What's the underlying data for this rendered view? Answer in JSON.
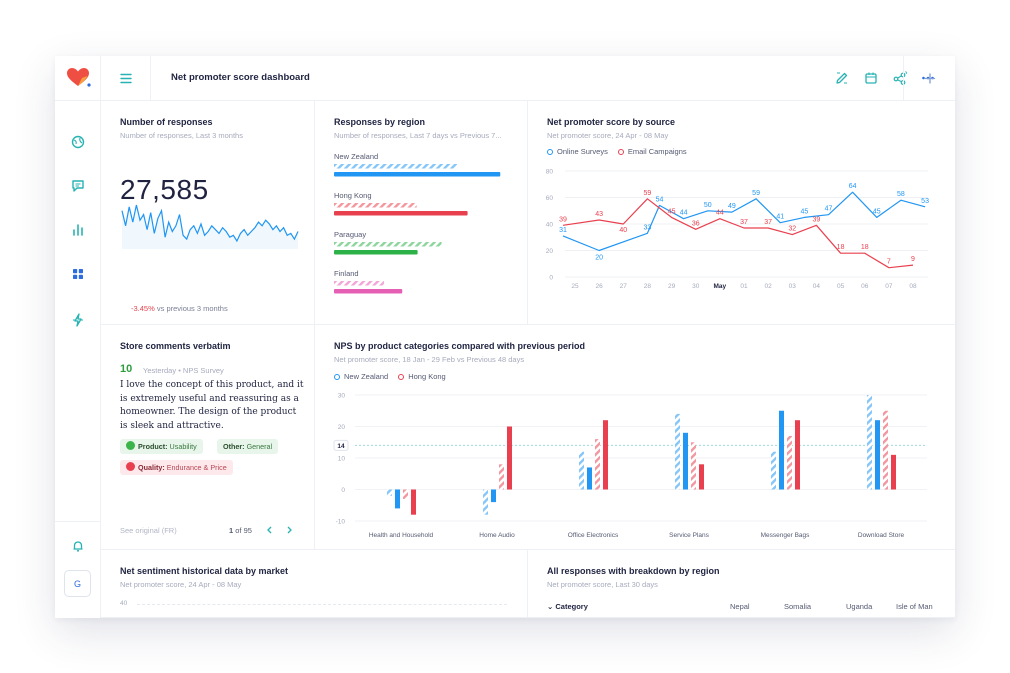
{
  "header": {
    "title": "Net promoter score dashboard"
  },
  "icons": {
    "logo": "heart-logo-icon",
    "menu": "hamburger-menu-icon",
    "rail": [
      "globe-icon",
      "chat-bubble-icon",
      "bar-chart-icon",
      "grid-icon",
      "lightning-icon"
    ],
    "bottom": [
      "bell-icon"
    ],
    "toolbar": [
      "edit-pencil-icon",
      "calendar-icon",
      "share-icon",
      "more-dots-icon",
      "plus-icon"
    ]
  },
  "user": {
    "initial": "G"
  },
  "colors": {
    "blue": "#2196f3",
    "red": "#e9404f",
    "green": "#2db24a",
    "pink": "#e55fb4"
  },
  "responses": {
    "title": "Number of responses",
    "subtitle": "Number of responses, Last 3 months",
    "value": "27,585",
    "delta": "-3.45%",
    "delta_label": "vs previous 3 months",
    "sparkline": [
      20,
      12,
      22,
      14,
      23,
      15,
      18,
      10,
      19,
      8,
      16,
      20,
      6,
      14,
      9,
      12,
      18,
      7,
      5,
      10,
      12,
      8,
      13,
      7,
      9,
      12,
      10,
      8,
      11,
      9,
      6,
      7,
      4,
      8,
      10,
      7,
      9,
      11,
      14,
      12,
      15,
      13,
      10,
      12,
      9,
      11,
      7,
      8,
      5,
      9
    ]
  },
  "regions": {
    "title": "Responses by region",
    "subtitle": "Number of responses, Last 7 days vs Previous 7...",
    "rows": [
      {
        "name": "New Zealand",
        "current": 173,
        "previous": 128
      },
      {
        "name": "Hong Kong",
        "current": 139,
        "previous": 86
      },
      {
        "name": "Paraguay",
        "current": 87,
        "previous": 112
      },
      {
        "name": "Finland",
        "current": 71,
        "previous": 52
      }
    ]
  },
  "nps_source": {
    "title": "Net promoter score by source",
    "subtitle": "Net promoter score, 24 Apr - 08 May",
    "legend": [
      "Online Surveys",
      "Email Campaigns"
    ]
  },
  "comments": {
    "title": "Store comments verbatim",
    "score": "10",
    "date": "Yesterday",
    "source": "• NPS Survey",
    "text": "I love the concept of this product, and it is extremely useful and reassuring as a homeowner. The design of the product is sleek and attractive.",
    "tags": [
      {
        "label": "Product:",
        "value": "Usability"
      },
      {
        "label": "Other:",
        "value": "General"
      },
      {
        "label": "Quality:",
        "value": "Endurance & Price"
      }
    ],
    "see_original": "See original (FR)",
    "page": "1",
    "page_total": "of 95"
  },
  "categories": {
    "title": "NPS by product categories compared with previous period",
    "subtitle": "Net promoter score, 18 Jan - 29 Feb vs Previous 48 days",
    "legend": [
      "New Zealand",
      "Hong Kong"
    ]
  },
  "sentiment": {
    "title": "Net sentiment historical data by market",
    "subtitle": "Net promoter score, 24 Apr - 08 May",
    "ytop": "40"
  },
  "breakdown": {
    "title": "All responses with breakdown by region",
    "subtitle": "Net promoter score, Last 30 days",
    "category_header": "Category",
    "columns": [
      "Nepal",
      "Somalia",
      "Uganda",
      "Isle of Man"
    ]
  },
  "chart_data": [
    {
      "type": "line",
      "title": "Net promoter score by source",
      "x": [
        "25",
        "26",
        "27",
        "28",
        "29",
        "30",
        "May",
        "01",
        "02",
        "03",
        "04",
        "05",
        "06",
        "07",
        "08"
      ],
      "ylim": [
        0,
        80
      ],
      "yticks": [
        "0",
        "20",
        "40",
        "60",
        "80"
      ],
      "grid": true,
      "legend": "top-left",
      "series": [
        {
          "name": "Online Surveys",
          "color": "#2196f3",
          "values": [
            31,
            20,
            null,
            33,
            54,
            44,
            50,
            49,
            59,
            41,
            45,
            47,
            64,
            45,
            58,
            53
          ],
          "points": [
            [
              0,
              31
            ],
            [
              1,
              20
            ],
            [
              3,
              33
            ],
            [
              3.5,
              54
            ],
            [
              4.5,
              44
            ],
            [
              5.5,
              50
            ],
            [
              6.5,
              49
            ],
            [
              7.5,
              59
            ],
            [
              8.5,
              41
            ],
            [
              9.5,
              45
            ],
            [
              10.5,
              47
            ],
            [
              11.5,
              64
            ],
            [
              12.5,
              45
            ],
            [
              13.5,
              58
            ],
            [
              14.5,
              53
            ]
          ]
        },
        {
          "name": "Email Campaigns",
          "color": "#e9404f",
          "points": [
            [
              0,
              39
            ],
            [
              1,
              43
            ],
            [
              2,
              40
            ],
            [
              3,
              59
            ],
            [
              4,
              45
            ],
            [
              5,
              36
            ],
            [
              6,
              44
            ],
            [
              7,
              37
            ],
            [
              8,
              37
            ],
            [
              9,
              32
            ],
            [
              10,
              39
            ],
            [
              11,
              18
            ],
            [
              12,
              18
            ],
            [
              13,
              7
            ],
            [
              14,
              9
            ]
          ]
        }
      ],
      "point_labels": {
        "Online Surveys": [
          "31",
          "20",
          "33",
          "54",
          "44",
          "50",
          "49",
          "59",
          "41",
          "45",
          "47",
          "64",
          "45",
          "58",
          "53"
        ],
        "Email Campaigns": [
          "39",
          "43",
          "40",
          "59",
          "45",
          "36",
          "44",
          "37",
          "37",
          "32",
          "39",
          "18",
          "18",
          "7",
          "9"
        ]
      }
    },
    {
      "type": "bar",
      "title": "NPS by product categories compared with previous period",
      "categories": [
        "Health and Household",
        "Home Audio",
        "Office Electronics",
        "Service Plans",
        "Messenger Bags",
        "Download Store"
      ],
      "ylim": [
        -10,
        30
      ],
      "yticks": [
        "-10",
        "0",
        "10",
        "20",
        "30"
      ],
      "reference_line": 14,
      "reference_label": "14",
      "legend": "top-left",
      "series": [
        {
          "name": "New Zealand",
          "color": "#2196f3",
          "previous": [
            -2,
            -8,
            12,
            24,
            12,
            30
          ],
          "current": [
            -6,
            -4,
            7,
            18,
            25,
            22
          ]
        },
        {
          "name": "Hong Kong",
          "color": "#e9404f",
          "previous": [
            -3,
            8,
            16,
            15,
            17,
            25
          ],
          "current": [
            -8,
            20,
            22,
            8,
            22,
            11
          ]
        }
      ]
    }
  ]
}
